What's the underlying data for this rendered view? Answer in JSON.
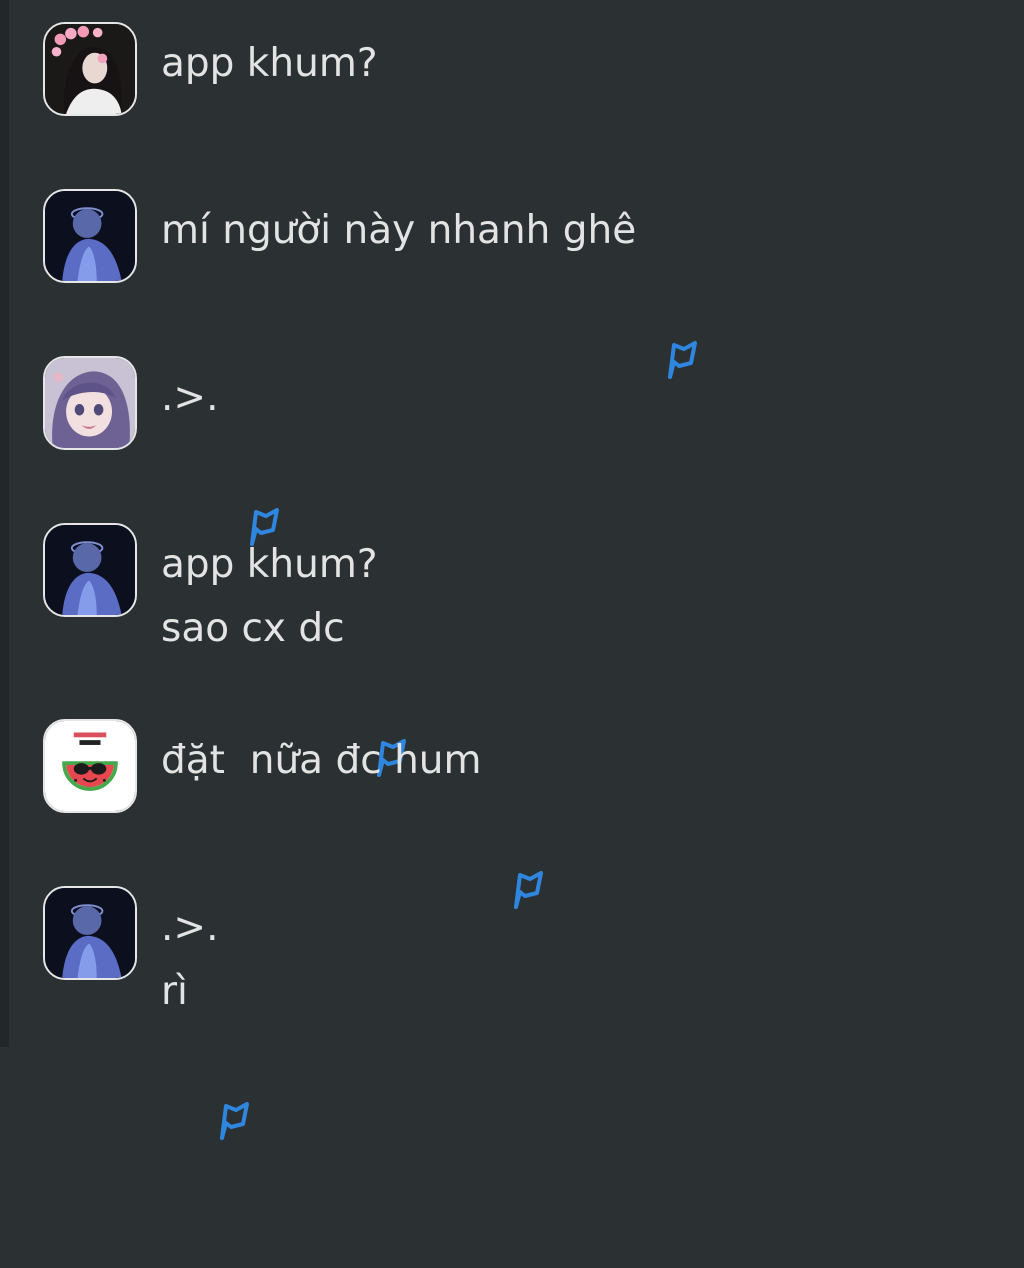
{
  "messages": [
    {
      "avatar": "girl-with-flower-crown",
      "lines": [
        "app khum?"
      ],
      "flag": false
    },
    {
      "avatar": "blue-glowing-figure",
      "lines": [
        "mí người này nhanh ghê"
      ],
      "flag": true
    },
    {
      "avatar": "anime-girl-purple-hair",
      "lines": [
        ".>."
      ],
      "flag": true
    },
    {
      "avatar": "blue-glowing-figure",
      "lines": [
        "app khum?",
        "sao cx dc"
      ],
      "flag": true
    },
    {
      "avatar": "watermelon-sunglasses",
      "lines": [
        "đặt  nữa đc hum"
      ],
      "flag": true
    },
    {
      "avatar": "blue-glowing-figure",
      "lines": [
        ".>.",
        "rì"
      ],
      "flag": true
    }
  ],
  "colors": {
    "background": "#2b3033",
    "text": "#e3e3e3",
    "flag": "#2f86de"
  },
  "icons": {
    "flag": "flag-icon"
  }
}
